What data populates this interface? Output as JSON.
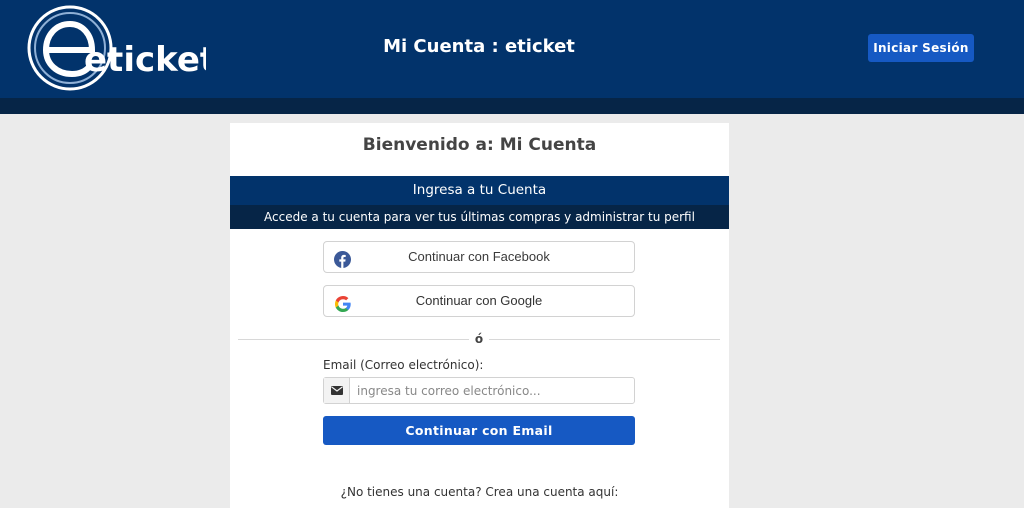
{
  "header": {
    "logo_text": "eticket",
    "title": "Mi Cuenta : eticket",
    "login_button": "Iniciar Sesión"
  },
  "card": {
    "welcome": "Bienvenido a: Mi Cuenta",
    "band_title": "Ingresa a tu Cuenta",
    "band_subtitle": "Accede a tu cuenta para ver tus últimas compras y administrar tu perfil",
    "facebook_button": "Continuar con Facebook",
    "google_button": "Continuar con Google",
    "or_text": "ó",
    "email_label": "Email (Correo electrónico):",
    "email_placeholder": "ingresa tu correo electrónico...",
    "email_value": "",
    "email_button": "Continuar con Email",
    "no_account_text": "¿No tienes una cuenta? Crea una cuenta aquí:"
  },
  "icons": {
    "facebook": "facebook-icon",
    "google": "google-icon",
    "envelope": "envelope-icon"
  },
  "colors": {
    "header_bg": "#02336b",
    "header_strip": "#062547",
    "primary_button": "#1659c3",
    "page_bg": "#ebebeb",
    "facebook_blue": "#3b5998"
  }
}
